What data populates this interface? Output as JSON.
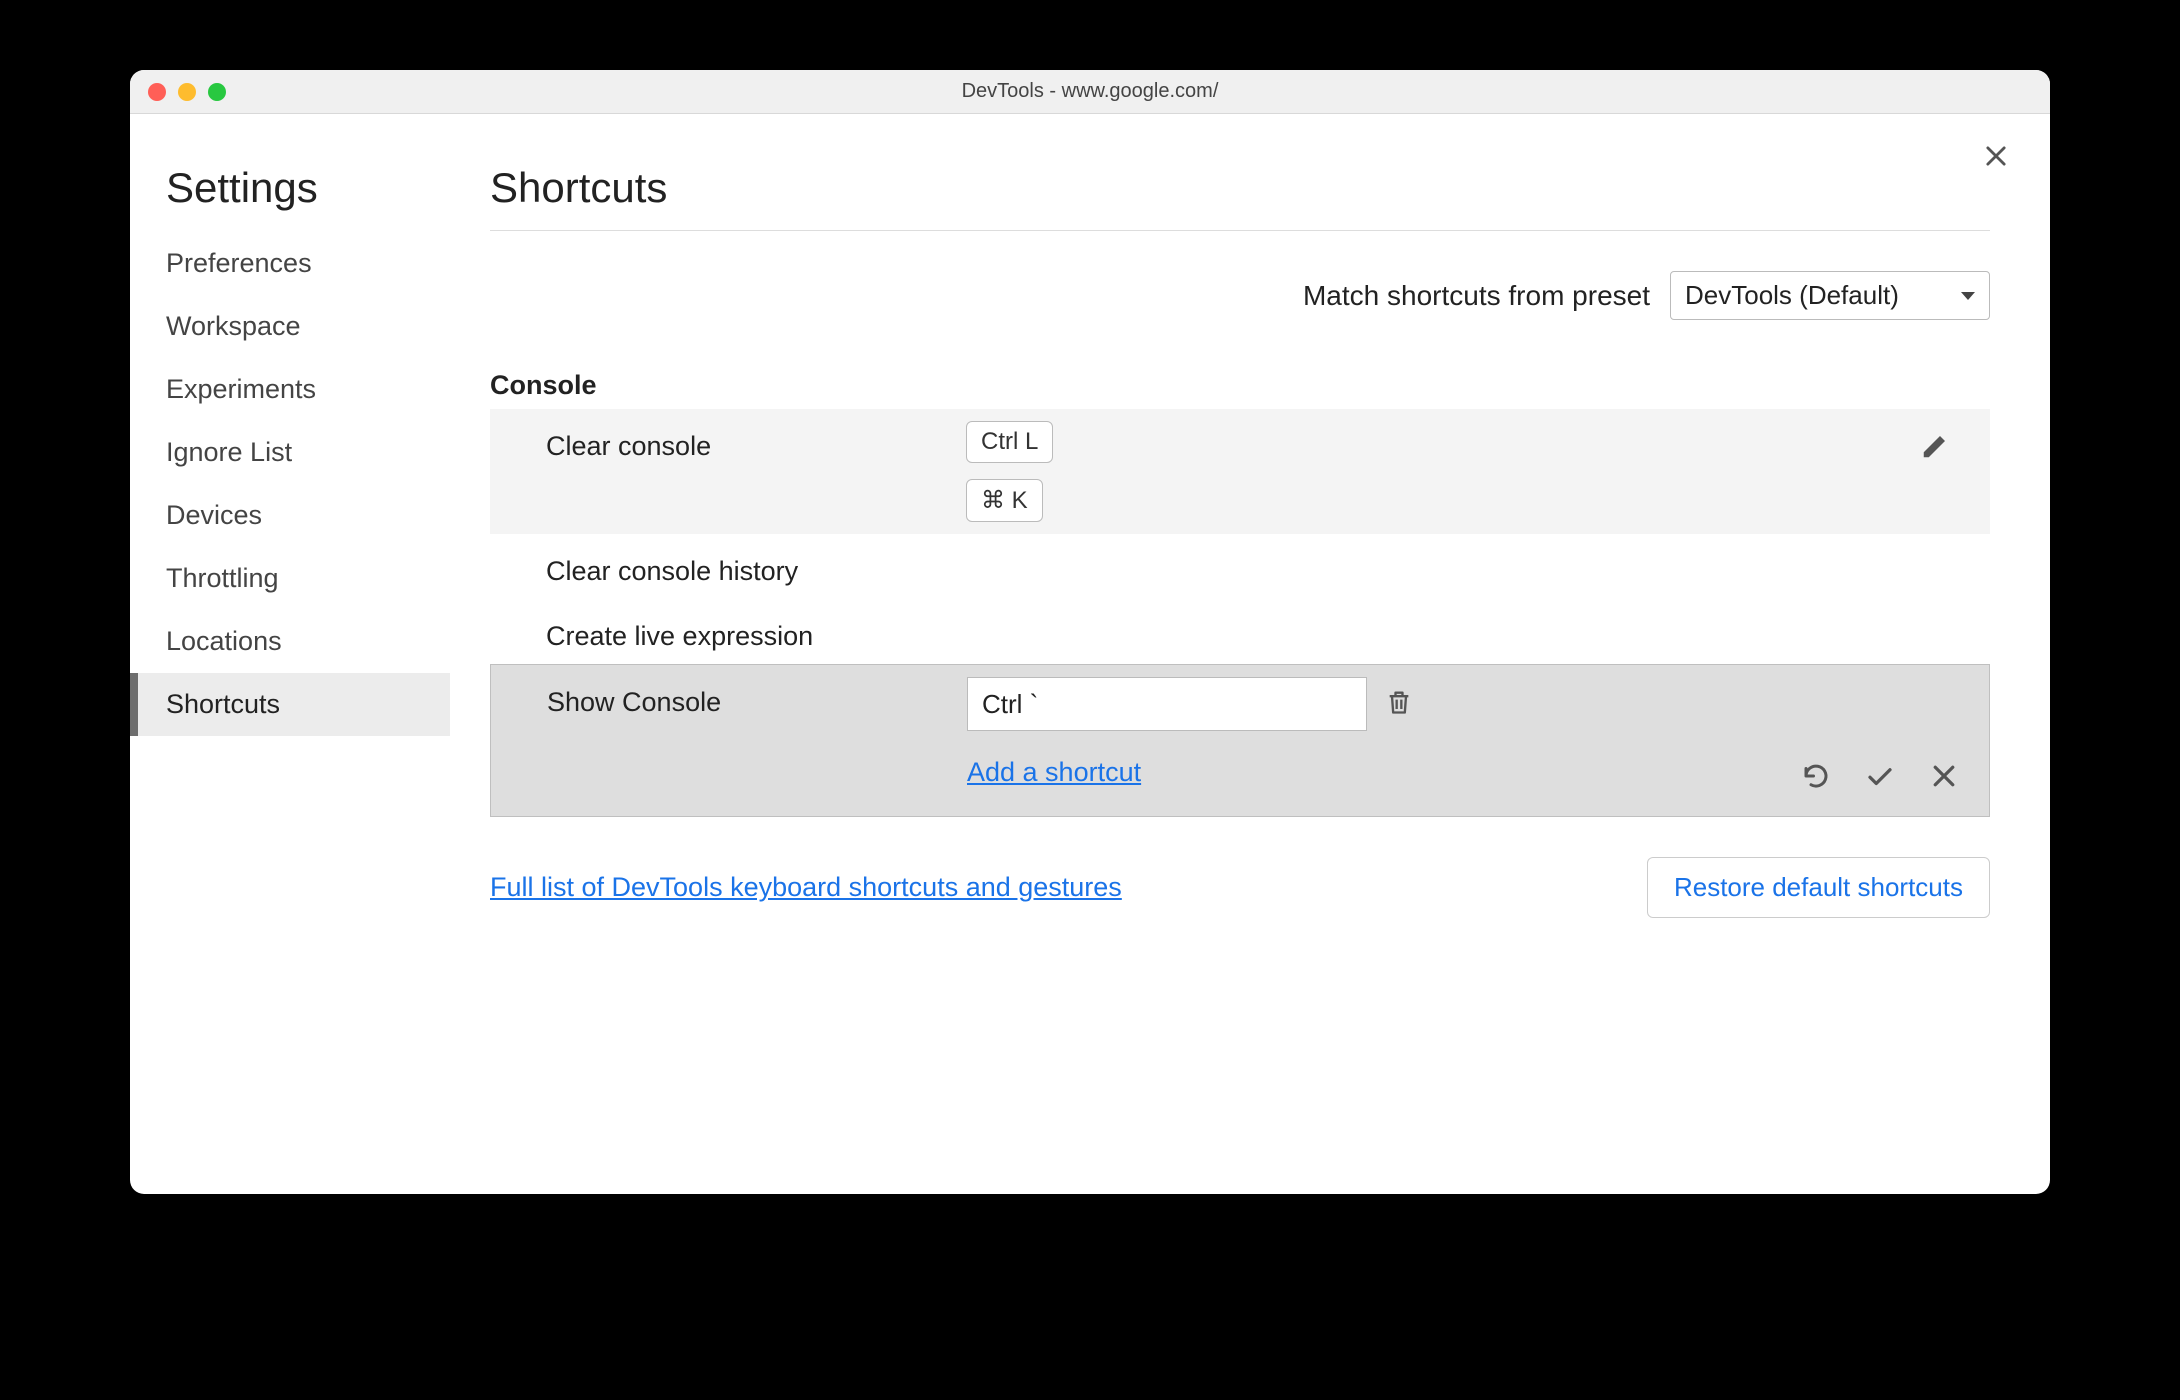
{
  "window": {
    "title": "DevTools - www.google.com/"
  },
  "sidebar": {
    "title": "Settings",
    "items": [
      {
        "label": "Preferences",
        "active": false
      },
      {
        "label": "Workspace",
        "active": false
      },
      {
        "label": "Experiments",
        "active": false
      },
      {
        "label": "Ignore List",
        "active": false
      },
      {
        "label": "Devices",
        "active": false
      },
      {
        "label": "Throttling",
        "active": false
      },
      {
        "label": "Locations",
        "active": false
      },
      {
        "label": "Shortcuts",
        "active": true
      }
    ]
  },
  "page": {
    "title": "Shortcuts",
    "preset_label": "Match shortcuts from preset",
    "preset_value": "DevTools (Default)"
  },
  "section": {
    "title": "Console",
    "rows": [
      {
        "label": "Clear console",
        "keys": [
          "Ctrl L",
          "⌘ K"
        ],
        "shaded": true,
        "editable_icon": true
      },
      {
        "label": "Clear console history",
        "keys": [],
        "shaded": false
      },
      {
        "label": "Create live expression",
        "keys": [],
        "shaded": false
      }
    ],
    "editing_row": {
      "label": "Show Console",
      "input_value": "Ctrl `",
      "add_link": "Add a shortcut"
    }
  },
  "footer": {
    "doc_link": "Full list of DevTools keyboard shortcuts and gestures",
    "restore_label": "Restore default shortcuts"
  }
}
